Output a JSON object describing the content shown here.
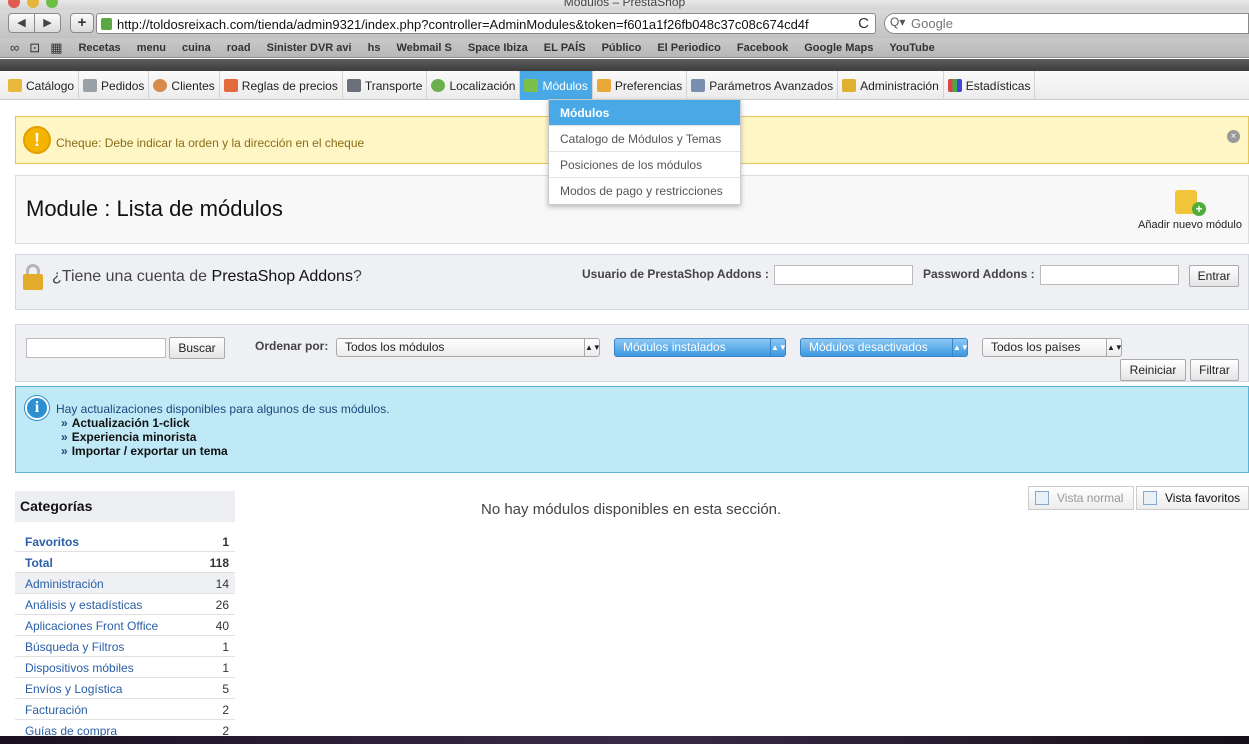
{
  "window": {
    "title": "Módulos – PrestaShop"
  },
  "browser": {
    "back_glyph": "◀",
    "forward_glyph": "▶",
    "plus_glyph": "+",
    "url": "http://toldosreixach.com/tienda/admin9321/index.php?controller=AdminModules&token=f601a1f26fb048c37c08c674cd4f",
    "reload_glyph": "C",
    "search_placeholder": "Google",
    "search_glyph": "Q▾",
    "reader_glyph": "∞",
    "book_glyph": "⊡",
    "grid_glyph": "▦",
    "bookmarks": [
      "Recetas",
      "menu",
      "cuina",
      "road",
      "Sinister DVR avi",
      "hs",
      "Webmail S",
      "Space Ibiza",
      "EL PAÍS",
      "Público",
      "El Periodico",
      "Facebook",
      "Google Maps",
      "YouTube"
    ]
  },
  "menu": [
    {
      "label": "Catálogo",
      "icon": "folder-icon"
    },
    {
      "label": "Pedidos",
      "icon": "cart-icon"
    },
    {
      "label": "Clientes",
      "icon": "user-icon"
    },
    {
      "label": "Reglas de precios",
      "icon": "price-tag-icon"
    },
    {
      "label": "Transporte",
      "icon": "truck-icon"
    },
    {
      "label": "Localización",
      "icon": "globe-icon"
    },
    {
      "label": "Módulos",
      "icon": "puzzle-icon",
      "active": true
    },
    {
      "label": "Preferencias",
      "icon": "preferences-icon"
    },
    {
      "label": "Parámetros Avanzados",
      "icon": "wrench-icon"
    },
    {
      "label": "Administración",
      "icon": "key-icon"
    },
    {
      "label": "Estadísticas",
      "icon": "stats-icon"
    }
  ],
  "dropdown": [
    "Módulos",
    "Catalogo de Módulos y Temas",
    "Posiciones de los módulos",
    "Modos de pago y restricciones"
  ],
  "warning": {
    "icon_glyph": "!",
    "text": "Cheque: Debe indicar la orden y la dirección en el cheque",
    "close_glyph": "×"
  },
  "header": {
    "title": "Module : Lista de módulos",
    "add_label": "Añadir nuevo módulo",
    "add_glyph": "+"
  },
  "addons": {
    "question_pre": "¿Tiene una cuenta de ",
    "question_brand": "PrestaShop Addons",
    "question_post": "?",
    "user_label": "Usuario de PrestaShop Addons :",
    "pass_label": "Password Addons :",
    "submit": "Entrar"
  },
  "filters": {
    "search_button": "Buscar",
    "order_label": "Ordenar por:",
    "selects": [
      "Todos los módulos",
      "Módulos instalados",
      "Módulos desactivados",
      "Todos los países"
    ],
    "select_arrows": "▲▼",
    "reset": "Reiniciar",
    "filter": "Filtrar"
  },
  "info": {
    "icon_glyph": "i",
    "message": "Hay actualizaciones disponibles para algunos de sus módulos.",
    "chevron": "»",
    "links": [
      "Actualización 1-click",
      "Experiencia minorista",
      "Importar / exportar un tema"
    ]
  },
  "categories": {
    "title": "Categorías",
    "items": [
      {
        "name": "Favoritos",
        "count": "1",
        "bold": true
      },
      {
        "name": "Total",
        "count": "118",
        "bold": true
      },
      {
        "name": "Administración",
        "count": "14"
      },
      {
        "name": "Análisis y estadísticas",
        "count": "26"
      },
      {
        "name": "Aplicaciones Front Office",
        "count": "40"
      },
      {
        "name": "Búsqueda y Filtros",
        "count": "1"
      },
      {
        "name": "Dispositivos móbiles",
        "count": "1"
      },
      {
        "name": "Envíos y Logística",
        "count": "5"
      },
      {
        "name": "Facturación",
        "count": "2"
      },
      {
        "name": "Guías de compra",
        "count": "2"
      }
    ]
  },
  "views": {
    "normal": "Vista normal",
    "favorites": "Vista favoritos"
  },
  "empty_message": "No hay módulos disponibles en esta sección."
}
